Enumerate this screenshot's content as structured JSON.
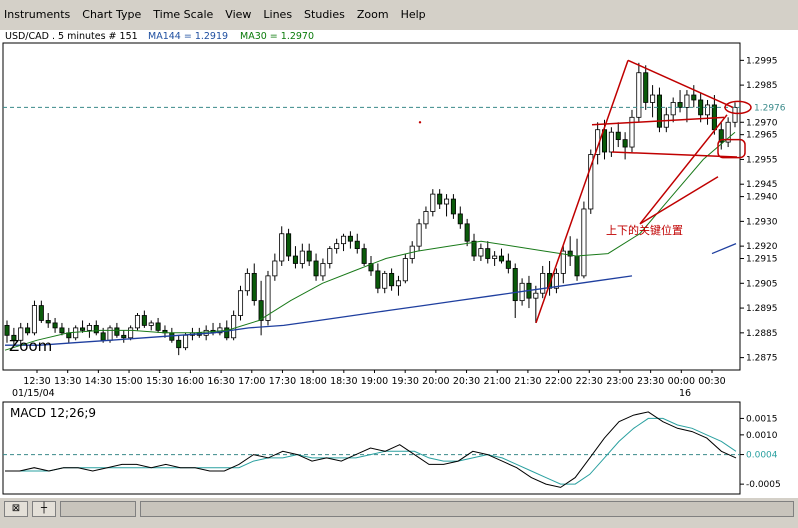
{
  "menu": [
    "Instruments",
    "Chart Type",
    "Time Scale",
    "View",
    "Lines",
    "Studies",
    "Zoom",
    "Help"
  ],
  "chart": {
    "header": {
      "symbol": "USD/CAD . 5 minutes # 151",
      "ma144": "MA144 = 1.2919",
      "ma30": "MA30 = 1.2970",
      "ma144_color": "#1f4fa0",
      "ma30_color": "#0a7a0a"
    },
    "current_price_label": "1.2976",
    "zoom_label": "Zoom",
    "annotation_text": "上下的关键位置",
    "date_labels": [
      "01/15/04",
      "16"
    ],
    "colors": {
      "up": "#ffffff",
      "down": "#0a5a0a",
      "ma144": "#1f3f9f",
      "ma30": "#1a7a1a",
      "annotation": "#c00000",
      "price_line": "#3a8a8a",
      "macd": "#000000",
      "signal": "#2aa0a0"
    }
  },
  "chart_data": [
    {
      "type": "candlestick",
      "title": "USD/CAD . 5 minutes # 151",
      "ylim": [
        1.287,
        1.3002
      ],
      "y_ticks": [
        "1.2995",
        "1.2985",
        "1.2970",
        "1.2965",
        "1.2955",
        "1.2945",
        "1.2940",
        "1.2930",
        "1.2920",
        "1.2915",
        "1.2905",
        "1.2895",
        "1.2885",
        "1.2875"
      ],
      "x_tick_labels": [
        "12:30",
        "13:30",
        "14:30",
        "15:00",
        "15:30",
        "16:00",
        "16:30",
        "17:00",
        "17:30",
        "18:00",
        "18:30",
        "19:00",
        "19:30",
        "20:00",
        "20:30",
        "21:00",
        "21:30",
        "22:00",
        "22:30",
        "23:00",
        "23:30",
        "00:00",
        "00:30"
      ],
      "ohlc": [
        [
          1.2888,
          1.289,
          1.2881,
          1.2884
        ],
        [
          1.2884,
          1.2887,
          1.288,
          1.2882
        ],
        [
          1.2882,
          1.2889,
          1.288,
          1.2887
        ],
        [
          1.2887,
          1.2889,
          1.2884,
          1.2885
        ],
        [
          1.2885,
          1.2898,
          1.2884,
          1.2896
        ],
        [
          1.2896,
          1.2898,
          1.2889,
          1.289
        ],
        [
          1.289,
          1.2893,
          1.2887,
          1.2889
        ],
        [
          1.2889,
          1.2891,
          1.2885,
          1.2887
        ],
        [
          1.2887,
          1.2889,
          1.2884,
          1.2885
        ],
        [
          1.2885,
          1.2887,
          1.2881,
          1.2883
        ],
        [
          1.2883,
          1.2888,
          1.2882,
          1.2887
        ],
        [
          1.2887,
          1.289,
          1.2885,
          1.2886
        ],
        [
          1.2886,
          1.2889,
          1.2883,
          1.2888
        ],
        [
          1.2888,
          1.289,
          1.2884,
          1.2885
        ],
        [
          1.2885,
          1.2887,
          1.2881,
          1.2882
        ],
        [
          1.2882,
          1.2888,
          1.2881,
          1.2887
        ],
        [
          1.2887,
          1.2889,
          1.2883,
          1.2884
        ],
        [
          1.2884,
          1.2886,
          1.2881,
          1.2883
        ],
        [
          1.2883,
          1.2888,
          1.2882,
          1.2887
        ],
        [
          1.2887,
          1.2893,
          1.2886,
          1.2892
        ],
        [
          1.2892,
          1.2894,
          1.2887,
          1.2888
        ],
        [
          1.2888,
          1.289,
          1.2886,
          1.2889
        ],
        [
          1.2889,
          1.2891,
          1.2885,
          1.2886
        ],
        [
          1.2886,
          1.2888,
          1.2883,
          1.2885
        ],
        [
          1.2885,
          1.2887,
          1.2881,
          1.2882
        ],
        [
          1.2882,
          1.2884,
          1.2876,
          1.2879
        ],
        [
          1.2879,
          1.2885,
          1.2878,
          1.2884
        ],
        [
          1.2884,
          1.2887,
          1.2882,
          1.2885
        ],
        [
          1.2885,
          1.2887,
          1.2883,
          1.2884
        ],
        [
          1.2884,
          1.2888,
          1.2882,
          1.2886
        ],
        [
          1.2886,
          1.2889,
          1.2884,
          1.2885
        ],
        [
          1.2885,
          1.2889,
          1.2884,
          1.2887
        ],
        [
          1.2887,
          1.289,
          1.2882,
          1.2883
        ],
        [
          1.2883,
          1.2894,
          1.2882,
          1.2892
        ],
        [
          1.2892,
          1.2904,
          1.289,
          1.2902
        ],
        [
          1.2902,
          1.2911,
          1.29,
          1.2909
        ],
        [
          1.2909,
          1.2913,
          1.2896,
          1.2898
        ],
        [
          1.2898,
          1.2906,
          1.2884,
          1.289
        ],
        [
          1.289,
          1.291,
          1.2888,
          1.2908
        ],
        [
          1.2908,
          1.2917,
          1.2906,
          1.2914
        ],
        [
          1.2914,
          1.2928,
          1.2912,
          1.2925
        ],
        [
          1.2925,
          1.2927,
          1.2914,
          1.2916
        ],
        [
          1.2916,
          1.292,
          1.2911,
          1.2913
        ],
        [
          1.2913,
          1.2921,
          1.2911,
          1.2918
        ],
        [
          1.2918,
          1.2921,
          1.2912,
          1.2914
        ],
        [
          1.2914,
          1.2917,
          1.2906,
          1.2908
        ],
        [
          1.2908,
          1.2915,
          1.2906,
          1.2913
        ],
        [
          1.2913,
          1.292,
          1.2911,
          1.2919
        ],
        [
          1.2919,
          1.2923,
          1.2917,
          1.2921
        ],
        [
          1.2921,
          1.2925,
          1.2918,
          1.2924
        ],
        [
          1.2924,
          1.2926,
          1.2919,
          1.2922
        ],
        [
          1.2922,
          1.2925,
          1.2917,
          1.2919
        ],
        [
          1.2919,
          1.2921,
          1.2912,
          1.2913
        ],
        [
          1.2913,
          1.2916,
          1.2908,
          1.291
        ],
        [
          1.291,
          1.2913,
          1.2901,
          1.2903
        ],
        [
          1.2903,
          1.291,
          1.2901,
          1.2909
        ],
        [
          1.2909,
          1.2911,
          1.2902,
          1.2904
        ],
        [
          1.2904,
          1.2908,
          1.29,
          1.2906
        ],
        [
          1.2906,
          1.2917,
          1.2905,
          1.2915
        ],
        [
          1.2915,
          1.2922,
          1.2913,
          1.292
        ],
        [
          1.292,
          1.2931,
          1.2918,
          1.2929
        ],
        [
          1.2929,
          1.2936,
          1.2927,
          1.2934
        ],
        [
          1.2934,
          1.2943,
          1.2932,
          1.2941
        ],
        [
          1.2941,
          1.2943,
          1.2935,
          1.2937
        ],
        [
          1.2937,
          1.2941,
          1.2932,
          1.2939
        ],
        [
          1.2939,
          1.2941,
          1.2931,
          1.2933
        ],
        [
          1.2933,
          1.2936,
          1.2927,
          1.2929
        ],
        [
          1.2929,
          1.2931,
          1.292,
          1.2922
        ],
        [
          1.2922,
          1.2925,
          1.2914,
          1.2916
        ],
        [
          1.2916,
          1.2921,
          1.2914,
          1.2919
        ],
        [
          1.2919,
          1.2922,
          1.2913,
          1.2915
        ],
        [
          1.2915,
          1.2918,
          1.2912,
          1.2916
        ],
        [
          1.2916,
          1.2919,
          1.2913,
          1.2914
        ],
        [
          1.2914,
          1.2917,
          1.2909,
          1.2911
        ],
        [
          1.2911,
          1.2913,
          1.2891,
          1.2898
        ],
        [
          1.2898,
          1.2907,
          1.2896,
          1.2905
        ],
        [
          1.2905,
          1.2908,
          1.2895,
          1.2899
        ],
        [
          1.2899,
          1.2904,
          1.2889,
          1.2901
        ],
        [
          1.2901,
          1.2912,
          1.2899,
          1.2909
        ],
        [
          1.2909,
          1.2914,
          1.29,
          1.2903
        ],
        [
          1.2903,
          1.2911,
          1.2901,
          1.2909
        ],
        [
          1.2909,
          1.292,
          1.2905,
          1.2918
        ],
        [
          1.2918,
          1.2924,
          1.2912,
          1.2916
        ],
        [
          1.2916,
          1.2923,
          1.2906,
          1.2908
        ],
        [
          1.2908,
          1.2938,
          1.2907,
          1.2935
        ],
        [
          1.2935,
          1.2959,
          1.2933,
          1.2957
        ],
        [
          1.2957,
          1.297,
          1.2953,
          1.2967
        ],
        [
          1.2967,
          1.2971,
          1.2955,
          1.2958
        ],
        [
          1.2958,
          1.2968,
          1.2956,
          1.2966
        ],
        [
          1.2966,
          1.297,
          1.296,
          1.2963
        ],
        [
          1.2963,
          1.2966,
          1.2955,
          1.296
        ],
        [
          1.296,
          1.2975,
          1.2958,
          1.2972
        ],
        [
          1.2972,
          1.2994,
          1.297,
          1.299
        ],
        [
          1.299,
          1.2993,
          1.2975,
          1.2978
        ],
        [
          1.2978,
          1.2985,
          1.2972,
          1.2981
        ],
        [
          1.2981,
          1.2984,
          1.2966,
          1.2968
        ],
        [
          1.2968,
          1.2976,
          1.2966,
          1.2973
        ],
        [
          1.2973,
          1.298,
          1.297,
          1.2978
        ],
        [
          1.2978,
          1.2983,
          1.2974,
          1.2976
        ],
        [
          1.2976,
          1.2983,
          1.297,
          1.2981
        ],
        [
          1.2981,
          1.2985,
          1.2976,
          1.2979
        ],
        [
          1.2979,
          1.2982,
          1.297,
          1.2973
        ],
        [
          1.2973,
          1.2979,
          1.2969,
          1.2977
        ],
        [
          1.2977,
          1.2981,
          1.2965,
          1.2967
        ],
        [
          1.2967,
          1.297,
          1.2959,
          1.2962
        ],
        [
          1.2962,
          1.2972,
          1.296,
          1.297
        ],
        [
          1.297,
          1.2978,
          1.2968,
          1.2976
        ]
      ],
      "series": [
        {
          "name": "MA144",
          "values": [
            1.288,
            1.288,
            1.2881,
            1.2882,
            1.2883,
            1.2884,
            1.2885,
            1.2887,
            1.2888,
            1.289,
            1.2892,
            1.2894,
            1.2896,
            1.2898,
            1.29,
            1.2902,
            1.2904,
            1.2906,
            1.2908
          ]
        },
        {
          "name": "MA30",
          "values": [
            1.2878,
            1.2882,
            1.2885,
            1.2886,
            1.2886,
            1.2885,
            1.2885,
            1.2886,
            1.289,
            1.2898,
            1.2905,
            1.291,
            1.2915,
            1.2918,
            1.292,
            1.2922,
            1.292,
            1.2918,
            1.2916,
            1.2917,
            1.2925,
            1.294,
            1.2955,
            1.2966
          ]
        }
      ]
    },
    {
      "type": "line",
      "title": "MACD 12;26;9",
      "ylim": [
        -0.0008,
        0.002
      ],
      "y_ticks": [
        "0.0015",
        "0.0010",
        "0.0004",
        "-0.0005"
      ],
      "series": [
        {
          "name": "MACD",
          "values": [
            -0.0001,
            -0.0001,
            0.0,
            -0.0001,
            0.0,
            0.0,
            -0.0001,
            0.0,
            0.0001,
            0.0001,
            0.0,
            0.0001,
            0.0,
            0.0,
            -0.0001,
            -0.0001,
            0.0001,
            0.0004,
            0.0003,
            0.0005,
            0.0004,
            0.0002,
            0.0003,
            0.0002,
            0.0004,
            0.0006,
            0.0005,
            0.0007,
            0.0004,
            0.0001,
            0.0001,
            0.0002,
            0.0005,
            0.0004,
            0.0002,
            0.0,
            -0.0003,
            -0.0005,
            -0.0006,
            -0.0003,
            0.0003,
            0.0009,
            0.0014,
            0.0016,
            0.0017,
            0.0014,
            0.0012,
            0.0011,
            0.0009,
            0.0005,
            0.0003
          ]
        },
        {
          "name": "Signal",
          "values": [
            -0.0001,
            -0.0001,
            -0.0001,
            -0.0001,
            0.0,
            0.0,
            0.0,
            0.0,
            0.0,
            0.0,
            0.0,
            0.0,
            0.0,
            0.0,
            0.0,
            0.0,
            0.0,
            0.0002,
            0.0003,
            0.0003,
            0.0004,
            0.0003,
            0.0003,
            0.0003,
            0.0003,
            0.0004,
            0.0005,
            0.0005,
            0.0005,
            0.0003,
            0.0002,
            0.0002,
            0.0003,
            0.0004,
            0.0003,
            0.0001,
            -0.0001,
            -0.0003,
            -0.0005,
            -0.0005,
            -0.0002,
            0.0003,
            0.0008,
            0.0012,
            0.0015,
            0.0015,
            0.0013,
            0.0012,
            0.001,
            0.0008,
            0.0005
          ]
        }
      ],
      "reference_line": 0.0004
    }
  ],
  "statusbar": {
    "btn1": "⊠",
    "btn2": "┼"
  }
}
